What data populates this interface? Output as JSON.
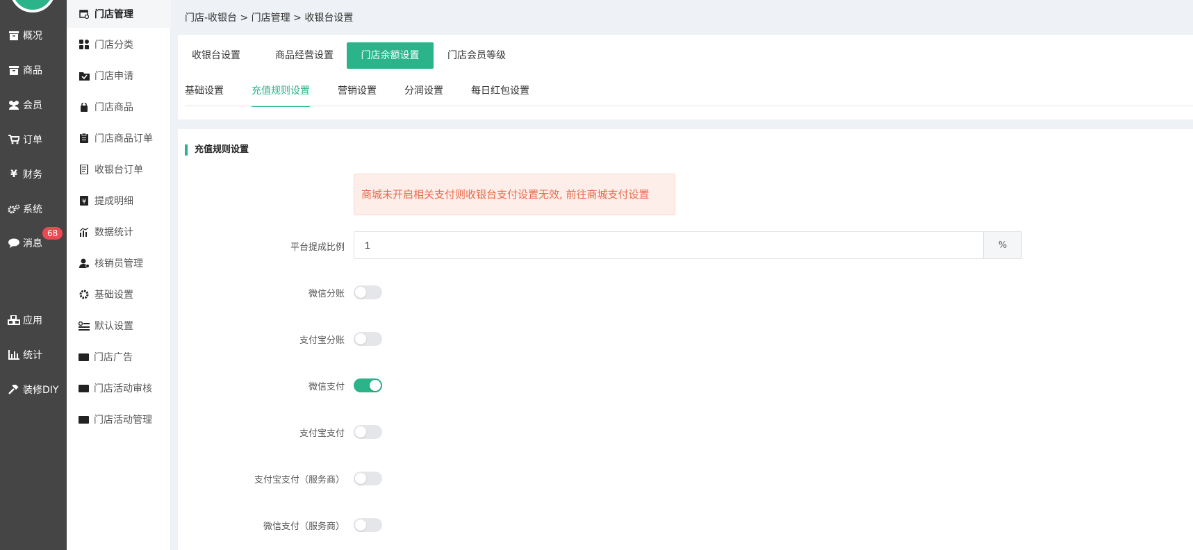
{
  "left_nav": {
    "items": [
      {
        "label": "概况",
        "icon": "archive-icon"
      },
      {
        "label": "商品",
        "icon": "archive-icon"
      },
      {
        "label": "会员",
        "icon": "users-icon"
      },
      {
        "label": "订单",
        "icon": "cart-icon"
      },
      {
        "label": "财务",
        "icon": "yen-icon"
      },
      {
        "label": "系统",
        "icon": "gears-icon"
      },
      {
        "label": "消息",
        "icon": "chat-icon"
      },
      {
        "label": "应用",
        "icon": "cubes-icon"
      },
      {
        "label": "统计",
        "icon": "bar-chart-icon"
      },
      {
        "label": "装修DIY",
        "icon": "gavel-icon"
      }
    ],
    "message_badge": "68"
  },
  "sub_nav": {
    "items": [
      {
        "label": "门店管理",
        "icon": "store-icon",
        "active": true
      },
      {
        "label": "门店分类",
        "icon": "grid-icon"
      },
      {
        "label": "门店申请",
        "icon": "checked-folder-icon"
      },
      {
        "label": "门店商品",
        "icon": "bag-icon"
      },
      {
        "label": "门店商品订单",
        "icon": "clipboard-icon"
      },
      {
        "label": "收银台订单",
        "icon": "receipt-icon"
      },
      {
        "label": "提成明细",
        "icon": "yen-note-icon"
      },
      {
        "label": "数据统计",
        "icon": "chart-icon"
      },
      {
        "label": "核销员管理",
        "icon": "user-check-icon"
      },
      {
        "label": "基础设置",
        "icon": "cog-icon"
      },
      {
        "label": "默认设置",
        "icon": "list-settings-icon"
      },
      {
        "label": "门店广告",
        "icon": "ad-icon"
      },
      {
        "label": "门店活动审核",
        "icon": "ad-icon"
      },
      {
        "label": "门店活动管理",
        "icon": "ad-icon"
      }
    ]
  },
  "breadcrumb": "门店-收银台 > 门店管理 > 收银台设置",
  "tabs": [
    {
      "label": "收银台设置"
    },
    {
      "label": "商品经营设置"
    },
    {
      "label": "门店余额设置",
      "active": true
    },
    {
      "label": "门店会员等级"
    }
  ],
  "subtabs": [
    {
      "label": "基础设置"
    },
    {
      "label": "充值规则设置",
      "active": true
    },
    {
      "label": "营销设置"
    },
    {
      "label": "分润设置"
    },
    {
      "label": "每日红包设置"
    }
  ],
  "section_title": "充值规则设置",
  "alert_text": "商城未开启相关支付则收银台支付设置无效, 前往商城支付设置",
  "commission": {
    "label": "平台提成比例",
    "value": "1",
    "suffix": "%"
  },
  "switches": [
    {
      "label": "微信分账",
      "on": false
    },
    {
      "label": "支付宝分账",
      "on": false
    },
    {
      "label": "微信支付",
      "on": true
    },
    {
      "label": "支付宝支付",
      "on": false
    },
    {
      "label": "支付宝支付（服务商）",
      "on": false
    },
    {
      "label": "微信支付（服务商）",
      "on": false
    }
  ],
  "colors": {
    "accent": "#2bb38a",
    "sidebar_bg": "#454545",
    "alert_text": "#ec6a4c",
    "badge": "#ea4b53"
  }
}
